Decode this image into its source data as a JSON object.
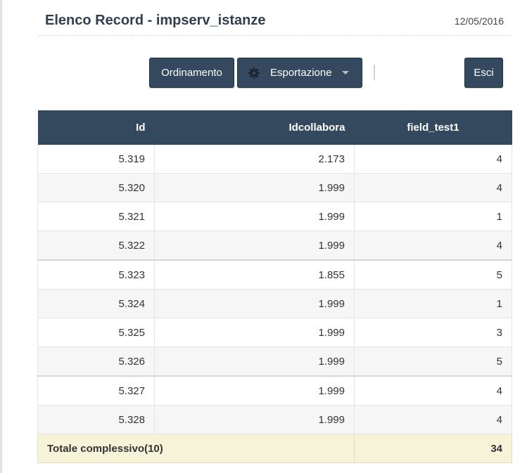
{
  "header": {
    "title": "Elenco Record - impserv_istanze",
    "date": "12/05/2016"
  },
  "toolbar": {
    "sort_label": "Ordinamento",
    "export_label": "Esportazione",
    "exit_label": "Esci",
    "export_icon": "gear-icon",
    "export_caret_icon": "caret-down-icon"
  },
  "table": {
    "columns": [
      "Id",
      "Idcollabora",
      "field_test1"
    ],
    "rows": [
      [
        "5.319",
        "2.173",
        "4"
      ],
      [
        "5.320",
        "1.999",
        "4"
      ],
      [
        "5.321",
        "1.999",
        "1"
      ],
      [
        "5.322",
        "1.999",
        "4"
      ],
      [
        "5.323",
        "1.855",
        "5"
      ],
      [
        "5.324",
        "1.999",
        "1"
      ],
      [
        "5.325",
        "1.999",
        "3"
      ],
      [
        "5.326",
        "1.999",
        "5"
      ],
      [
        "5.327",
        "1.999",
        "4"
      ],
      [
        "5.328",
        "1.999",
        "4"
      ]
    ],
    "total_label": "Totale complessivo(10)",
    "total_value": "34"
  },
  "colors": {
    "header_bg": "#34495e",
    "button_bg": "#34495e",
    "total_row_bg": "#f6f3d9",
    "title_color": "#2f4050"
  }
}
